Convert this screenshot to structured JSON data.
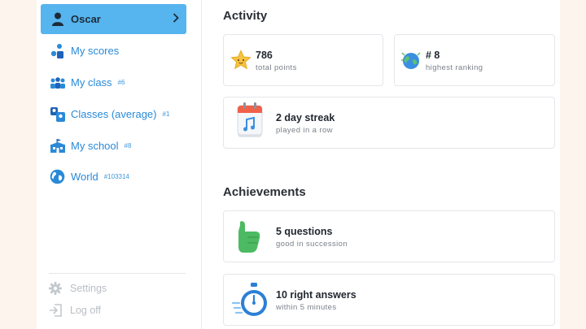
{
  "sidebar": {
    "items": [
      {
        "label": "Oscar",
        "rank": "",
        "icon": "user-icon"
      },
      {
        "label": "My scores",
        "rank": "",
        "icon": "scores-icon"
      },
      {
        "label": "My class",
        "rank": "#6",
        "icon": "class-icon"
      },
      {
        "label": "Classes (average)",
        "rank": "#1",
        "icon": "classes-average-icon"
      },
      {
        "label": "My school",
        "rank": "#8",
        "icon": "school-icon"
      },
      {
        "label": "World",
        "rank": "#103314",
        "icon": "globe-icon"
      }
    ],
    "footer": {
      "settings_label": "Settings",
      "logoff_label": "Log off"
    }
  },
  "activity": {
    "title": "Activity",
    "cards": {
      "points": {
        "value": "786",
        "caption": "total points",
        "icon": "star-icon"
      },
      "ranking": {
        "value": "# 8",
        "caption": "highest ranking",
        "icon": "earth-icon"
      },
      "streak": {
        "value": "2 day streak",
        "caption": "played in a row",
        "icon": "calendar-icon"
      }
    }
  },
  "achievements": {
    "title": "Achievements",
    "cards": {
      "questions": {
        "value": "5 questions",
        "caption": "good in succession",
        "icon": "thumbs-up-icon"
      },
      "answers": {
        "value": "10 right answers",
        "caption": "within 5 minutes",
        "icon": "stopwatch-icon"
      }
    }
  },
  "colors": {
    "accent": "#56b4ee",
    "link": "#2a8ad8",
    "page_background": "#fdf4ee",
    "thumb": "#4cba62",
    "stopwatch": "#2b7fd6"
  }
}
